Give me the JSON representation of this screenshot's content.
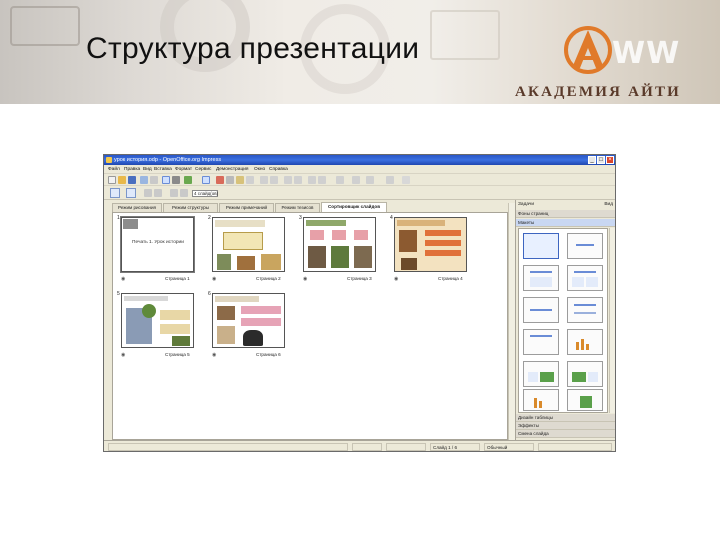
{
  "slide": {
    "title": "Структура презентации",
    "brand": "АКАДЕМИЯ АЙТИ",
    "logo_text": "WW"
  },
  "window": {
    "title": "урок история.odp - OpenOffice.org Impress",
    "menu": [
      "Файл",
      "Правка",
      "Вид",
      "Вставка",
      "Формат",
      "Сервис",
      "Демонстрация",
      "Окно",
      "Справка"
    ],
    "zoom_combo": "4 слайд(ов)",
    "view_tabs": [
      {
        "label": "Режим рисования",
        "active": false
      },
      {
        "label": "Режим структуры",
        "active": false
      },
      {
        "label": "Режим примечаний",
        "active": false
      },
      {
        "label": "Режим тезисов",
        "active": false
      },
      {
        "label": "Сортировщик слайдов",
        "active": true
      }
    ],
    "slides": [
      {
        "number": "1",
        "caption": "Страница 1",
        "title": "Печать 1. Урок истории"
      },
      {
        "number": "2",
        "caption": "Страница 2",
        "title": ""
      },
      {
        "number": "3",
        "caption": "Страница 3",
        "title": ""
      },
      {
        "number": "4",
        "caption": "Страница 4",
        "title": ""
      },
      {
        "number": "5",
        "caption": "Страница 5",
        "title": ""
      },
      {
        "number": "6",
        "caption": "Страница 6",
        "title": ""
      }
    ],
    "task_pane": {
      "title": "Задачи",
      "view_label": "Вид",
      "sections": [
        "Фоны страниц",
        "Макеты",
        "Дизайн таблицы",
        "Эффекты",
        "Смена слайда"
      ]
    },
    "status": {
      "slide": "Слайд 1 / 6",
      "style": "Обычный"
    }
  },
  "colors": {
    "titlebar": "#2a56c6",
    "logo_orange": "#e07a2a",
    "brand": "#5a3a2a"
  }
}
